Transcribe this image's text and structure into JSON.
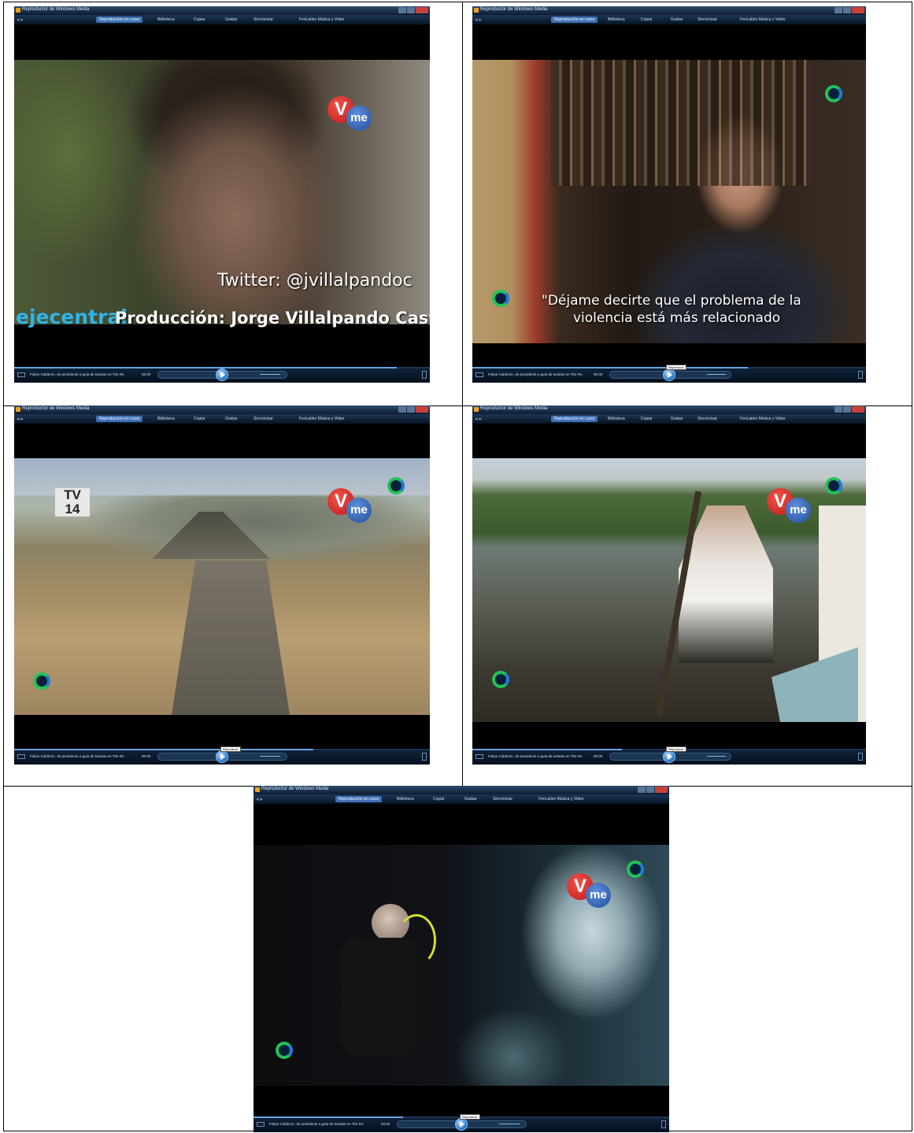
{
  "player": {
    "window_title": "Reproductor de Windows Media",
    "nav_arrows": "◂ ▸",
    "tabs": [
      "Reproducción en curso",
      "Biblioteca",
      "Copiar",
      "Grabar",
      "Sincronizar",
      "FenLatino Música y Video"
    ],
    "now_playing": "Felipe Calderón, de presidente a guía de turistas en The Ro...",
    "elapsed_time": "00:00",
    "play_tooltip": "Reproducir"
  },
  "frames": [
    {
      "caption_handle": "Twitter: @jvillalpandoc",
      "brand_logo": "ejecentral",
      "credit": "Producción: Jorge Villalpando Castro",
      "vme_v": "V",
      "vme_me": "me",
      "seek_progress": 0.92
    },
    {
      "subtitle_line1": "\"Déjame decirte que el problema de la",
      "subtitle_line2": "violencia está más relacionado",
      "seek_progress": 0.7
    },
    {
      "rating": "TV 14",
      "vme_v": "V",
      "vme_me": "me",
      "seek_progress": 0.72
    },
    {
      "vme_v": "V",
      "vme_me": "me",
      "seek_progress": 0.38
    },
    {
      "vme_v": "V",
      "vme_me": "me",
      "seek_progress": 0.36
    }
  ],
  "colors": {
    "vme_red": "#d0231f",
    "vme_blue": "#2c5fb3",
    "ring_green": "#21c25a",
    "ring_blue": "#1f7cd6",
    "ejecentral_blue": "#2fb4e8",
    "ejecentral_green": "#6fd11d"
  }
}
